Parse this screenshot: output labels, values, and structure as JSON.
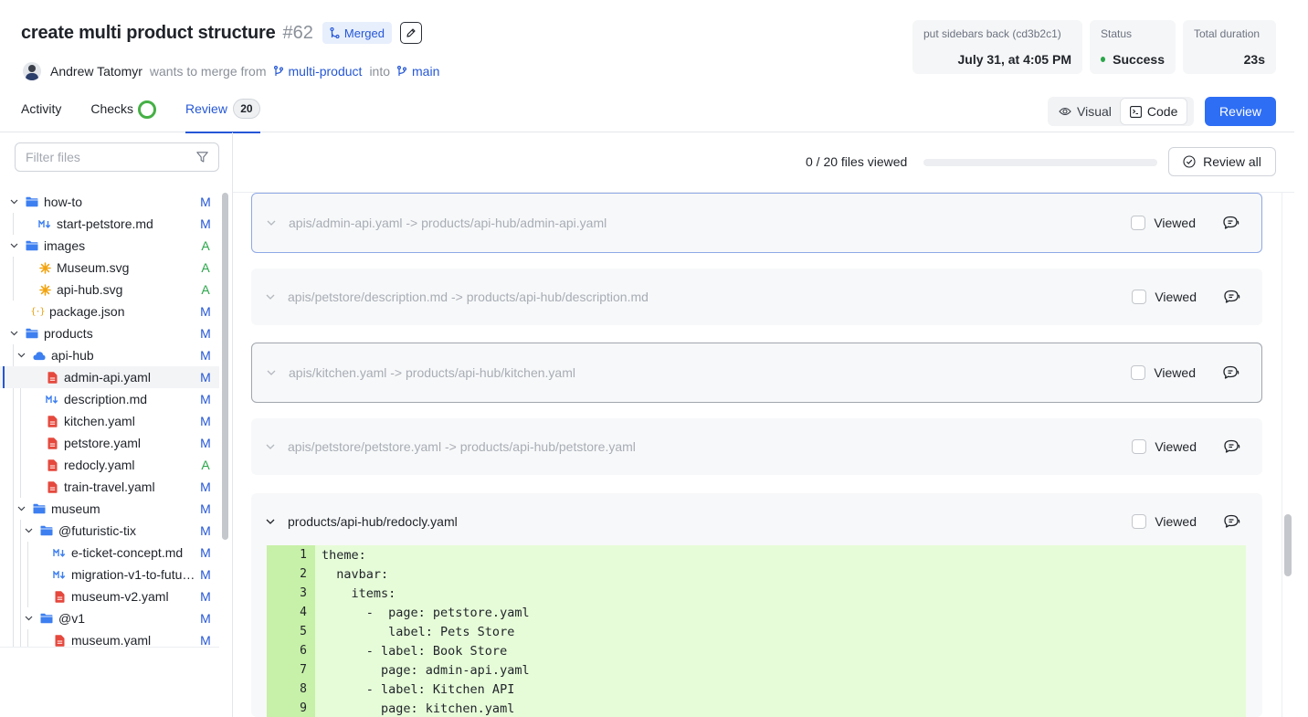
{
  "header": {
    "title": "create multi product structure",
    "pr_number": "#62",
    "status_badge": "Merged",
    "author": "Andrew Tatomyr",
    "merge_text": "wants to merge from",
    "source_branch": "multi-product",
    "into_text": "into",
    "target_branch": "main"
  },
  "info_cards": {
    "commit_label": "put sidebars back (cd3b2c1)",
    "commit_date": "July 31, at 4:05 PM",
    "status_label": "Status",
    "status_value": "Success",
    "duration_label": "Total duration",
    "duration_value": "23s"
  },
  "tabs": [
    {
      "label": "Activity"
    },
    {
      "label": "Checks"
    },
    {
      "label": "Review",
      "count": "20"
    }
  ],
  "view_toggle": {
    "visual": "Visual",
    "code": "Code",
    "selected": "Code"
  },
  "review_button": "Review",
  "sidebar": {
    "filter_placeholder": "Filter files",
    "tree": [
      {
        "name": "how-to",
        "type": "folder",
        "status": "M"
      },
      {
        "name": "start-petstore.md",
        "type": "md",
        "status": "M"
      },
      {
        "name": "images",
        "type": "folder",
        "status": "A"
      },
      {
        "name": "Museum.svg",
        "type": "svg",
        "status": "A"
      },
      {
        "name": "api-hub.svg",
        "type": "svg",
        "status": "A"
      },
      {
        "name": "package.json",
        "type": "json",
        "status": "M"
      },
      {
        "name": "products",
        "type": "folder",
        "status": "M"
      },
      {
        "name": "api-hub",
        "type": "cloud",
        "status": "M"
      },
      {
        "name": "admin-api.yaml",
        "type": "yaml",
        "status": "M"
      },
      {
        "name": "description.md",
        "type": "md",
        "status": "M"
      },
      {
        "name": "kitchen.yaml",
        "type": "yaml",
        "status": "M"
      },
      {
        "name": "petstore.yaml",
        "type": "yaml",
        "status": "M"
      },
      {
        "name": "redocly.yaml",
        "type": "yaml",
        "status": "A"
      },
      {
        "name": "train-travel.yaml",
        "type": "yaml",
        "status": "M"
      },
      {
        "name": "museum",
        "type": "folder",
        "status": "M"
      },
      {
        "name": "@futuristic-tix",
        "type": "folder",
        "status": "M"
      },
      {
        "name": "e-ticket-concept.md",
        "type": "md",
        "status": "M"
      },
      {
        "name": "migration-v1-to-futur…",
        "type": "md",
        "status": "M"
      },
      {
        "name": "museum-v2.yaml",
        "type": "yaml",
        "status": "M"
      },
      {
        "name": "@v1",
        "type": "folder",
        "status": "M"
      },
      {
        "name": "museum.yaml",
        "type": "yaml",
        "status": "M"
      }
    ]
  },
  "files_bar": {
    "viewed_text": "0 / 20 files viewed",
    "viewed_fraction": 0,
    "review_all": "Review all"
  },
  "files": [
    {
      "path": "apis/admin-api.yaml -> products/api-hub/admin-api.yaml",
      "viewed_label": "Viewed",
      "expanded": false
    },
    {
      "path": "apis/petstore/description.md -> products/api-hub/description.md",
      "viewed_label": "Viewed",
      "expanded": false
    },
    {
      "path": "apis/kitchen.yaml -> products/api-hub/kitchen.yaml",
      "viewed_label": "Viewed",
      "expanded": false
    },
    {
      "path": "apis/petstore/petstore.yaml -> products/api-hub/petstore.yaml",
      "viewed_label": "Viewed",
      "expanded": false
    },
    {
      "path": "products/api-hub/redocly.yaml",
      "viewed_label": "Viewed",
      "expanded": true
    }
  ],
  "code_lines": [
    {
      "n": "1",
      "text": "theme:"
    },
    {
      "n": "2",
      "text": "  navbar:"
    },
    {
      "n": "3",
      "text": "    items:"
    },
    {
      "n": "4",
      "text": "      -  page: petstore.yaml"
    },
    {
      "n": "5",
      "text": "         label: Pets Store"
    },
    {
      "n": "6",
      "text": "      - label: Book Store"
    },
    {
      "n": "7",
      "text": "        page: admin-api.yaml"
    },
    {
      "n": "8",
      "text": "      - label: Kitchen API"
    },
    {
      "n": "9",
      "text": "        page: kitchen.yaml"
    }
  ],
  "colors": {
    "accent": "#2557d6",
    "primary_button": "#2e6ef5",
    "added_status": "#2aa64a",
    "diff_added_bg": "#e6fcd8",
    "diff_added_gutter": "#c7f0a8"
  }
}
